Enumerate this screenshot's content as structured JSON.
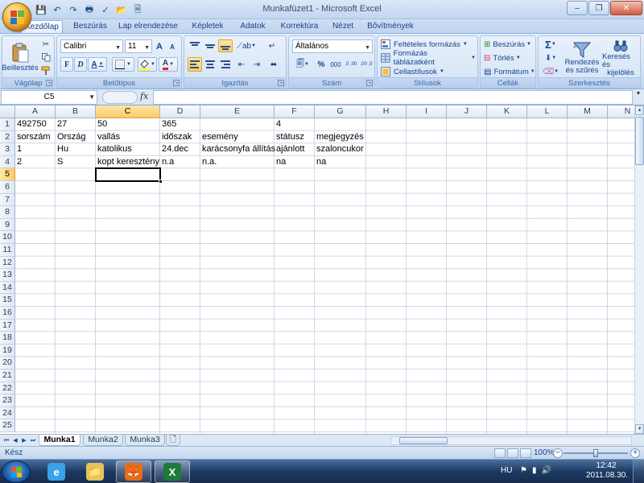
{
  "window": {
    "title": "Munkafüzet1 - Microsoft Excel",
    "controls": {
      "minimize": "–",
      "restore": "❐",
      "close": "✕"
    }
  },
  "quick_access": [
    {
      "name": "save-icon",
      "glyph": "💾"
    },
    {
      "name": "undo-icon",
      "glyph": "↶"
    },
    {
      "name": "redo-icon",
      "glyph": "↷"
    },
    {
      "name": "print-icon",
      "glyph": "🖶"
    },
    {
      "name": "spellcheck-icon",
      "glyph": "✓"
    },
    {
      "name": "open-icon",
      "glyph": "📂"
    },
    {
      "name": "save-as-icon",
      "glyph": "🗎"
    }
  ],
  "ribbon_tabs": [
    "Kezdőlap",
    "Beszúrás",
    "Lap elrendezése",
    "Képletek",
    "Adatok",
    "Korrektúra",
    "Nézet",
    "Bővítmények"
  ],
  "active_tab": "Kezdőlap",
  "ribbon": {
    "clipboard": {
      "label": "Vágólap",
      "paste": "Beillesztés"
    },
    "font": {
      "label": "Betűtípus",
      "name": "Calibri",
      "size": "11",
      "bold": "F",
      "italic": "D",
      "underline": "A",
      "grow": "A",
      "shrink": "A",
      "font_color_letter": "A"
    },
    "alignment": {
      "label": "Igazítás"
    },
    "number": {
      "label": "Szám",
      "format": "Általános",
      "percent": "%",
      "thousands": "000",
      "inc_decimal": ",0 ,00",
      "dec_decimal": ",00 ,0"
    },
    "styles": {
      "label": "Stílusok",
      "conditional": "Feltételes formázás",
      "as_table": "Formázás táblázatként",
      "cell_styles": "Cellastílusok"
    },
    "cells": {
      "label": "Cellák",
      "insert": "Beszúrás",
      "delete": "Törlés",
      "format": "Formátum"
    },
    "editing": {
      "label": "Szerkesztés",
      "sort_filter_1": "Rendezés",
      "sort_filter_2": "és szűrés",
      "find_select_1": "Keresés és",
      "find_select_2": "kijelölés",
      "sum": "Σ"
    }
  },
  "formula_bar": {
    "name_box": "C5",
    "fx": "fx",
    "content": ""
  },
  "sheet": {
    "columns": [
      "A",
      "B",
      "C",
      "D",
      "E",
      "F",
      "G",
      "H",
      "I",
      "J",
      "K",
      "L",
      "M",
      "N"
    ],
    "row_count": 25,
    "selected_column": "C",
    "selected_row": 5,
    "rows": [
      [
        "492750",
        "27",
        "50",
        "365",
        "",
        "4",
        ""
      ],
      [
        "sorszám",
        "Ország",
        "vallás",
        "időszak",
        "esemény",
        "státusz",
        "megjegyzés"
      ],
      [
        "1",
        "Hu",
        "katolikus",
        "24.dec",
        "karácsonyfa állítás",
        "ajánlott",
        "szaloncukor"
      ],
      [
        "2",
        "S",
        "kopt keresztény",
        "n.a",
        "n.a.",
        "na",
        "na"
      ]
    ]
  },
  "sheet_tabs": [
    "Munka1",
    "Munka2",
    "Munka3"
  ],
  "active_sheet": "Munka1",
  "status": {
    "text": "Kész",
    "zoom": "100%"
  },
  "taskbar": {
    "apps": [
      {
        "name": "internet-explorer-icon",
        "glyph": "e",
        "color": "#3aa0e8"
      },
      {
        "name": "windows-explorer-icon",
        "glyph": "📁",
        "color": "#e8c35a"
      },
      {
        "name": "firefox-icon",
        "glyph": "🦊",
        "color": "#e86a1a"
      },
      {
        "name": "excel-icon",
        "glyph": "X",
        "color": "#1f7a3a"
      }
    ],
    "language": "HU",
    "time": "12:42",
    "date": "2011.08.30."
  },
  "colors": {
    "accent": "#15428b",
    "selection": "#f9cb6c",
    "ribbon_bg": "#cfe0f4"
  }
}
